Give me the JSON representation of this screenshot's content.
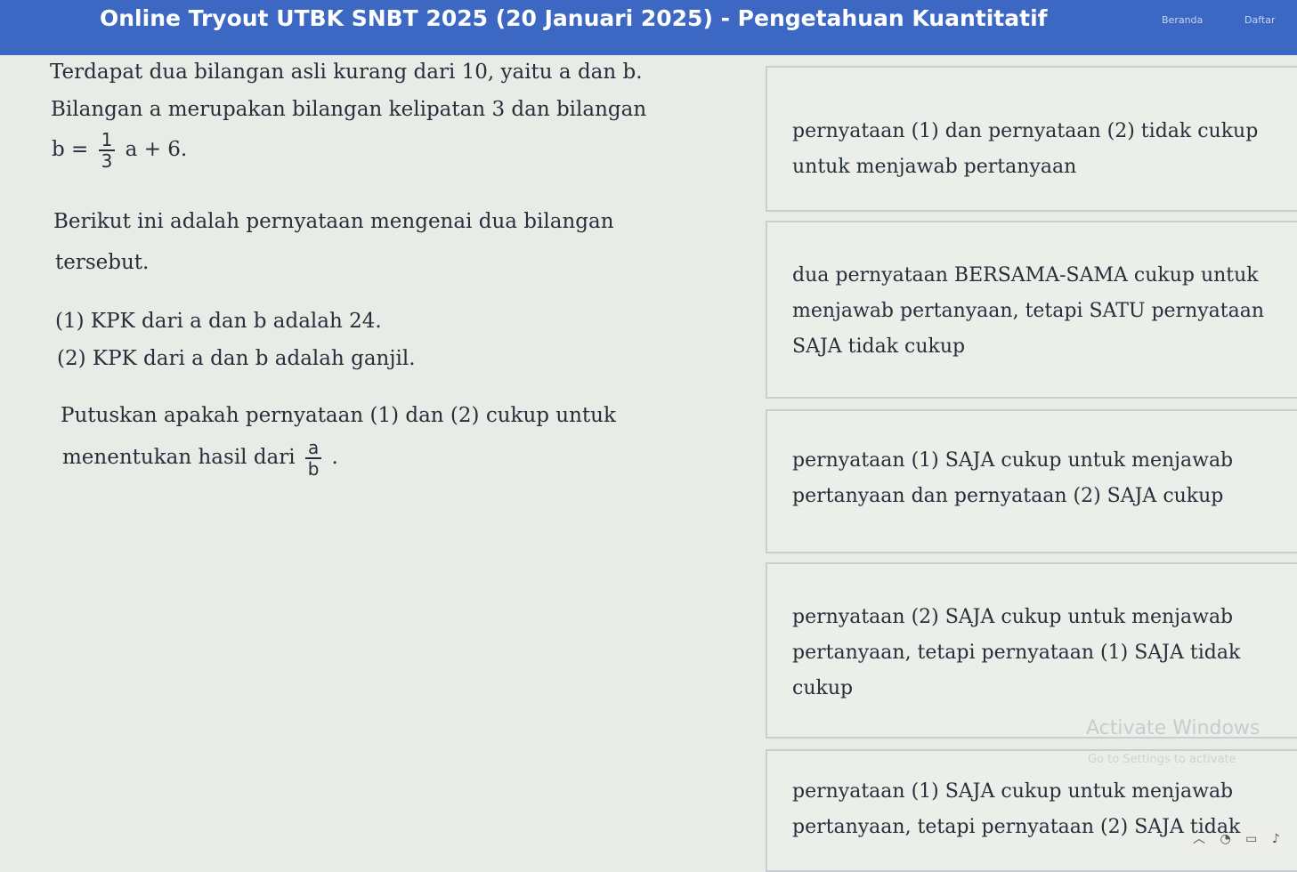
{
  "header": {
    "title": "Online Tryout UTBK SNBT 2025 (20 Januari 2025) - Pengetahuan Kuantitatif",
    "nav_beranda": "Beranda",
    "nav_daftar": "Daftar"
  },
  "question": {
    "line1": "Terdapat dua bilangan asli kurang dari 10, yaitu a dan b.",
    "line2": "Bilangan a merupakan bilangan kelipatan 3 dan bilangan",
    "eq_lhs": "b =",
    "eq_frac_num": "1",
    "eq_frac_den": "3",
    "eq_rhs": "a + 6.",
    "line4": "Berikut ini adalah pernyataan mengenai dua bilangan",
    "line5": "tersebut.",
    "statement1": "(1) KPK dari a dan b adalah 24.",
    "statement2": "(2) KPK dari a dan b adalah ganjil.",
    "line8": "Putuskan apakah pernyataan (1) dan (2) cukup untuk",
    "line9": "menentukan hasil dari",
    "ratio_num": "a",
    "ratio_den": "b",
    "line9_end": "."
  },
  "options": [
    {
      "text": "pernyataan (1) dan pernyataan (2) tidak cukup untuk menjawab pertanyaan"
    },
    {
      "text": "dua pernyataan BERSAMA-SAMA cukup untuk menjawab pertanyaan, tetapi SATU pernyataan SAJA tidak cukup"
    },
    {
      "text": "pernyataan (1) SAJA cukup untuk menjawab pertanyaan dan pernyataan (2) SAJA cukup"
    },
    {
      "text": "pernyataan (2) SAJA cukup untuk menjawab pertanyaan, tetapi pernyataan (1) SAJA tidak cukup"
    },
    {
      "text": "pernyataan (1) SAJA cukup untuk menjawab pertanyaan, tetapi pernyataan (2) SAJA tidak"
    }
  ],
  "watermark": {
    "line1": "Activate Windows",
    "line2": "Go to Settings to activate"
  }
}
